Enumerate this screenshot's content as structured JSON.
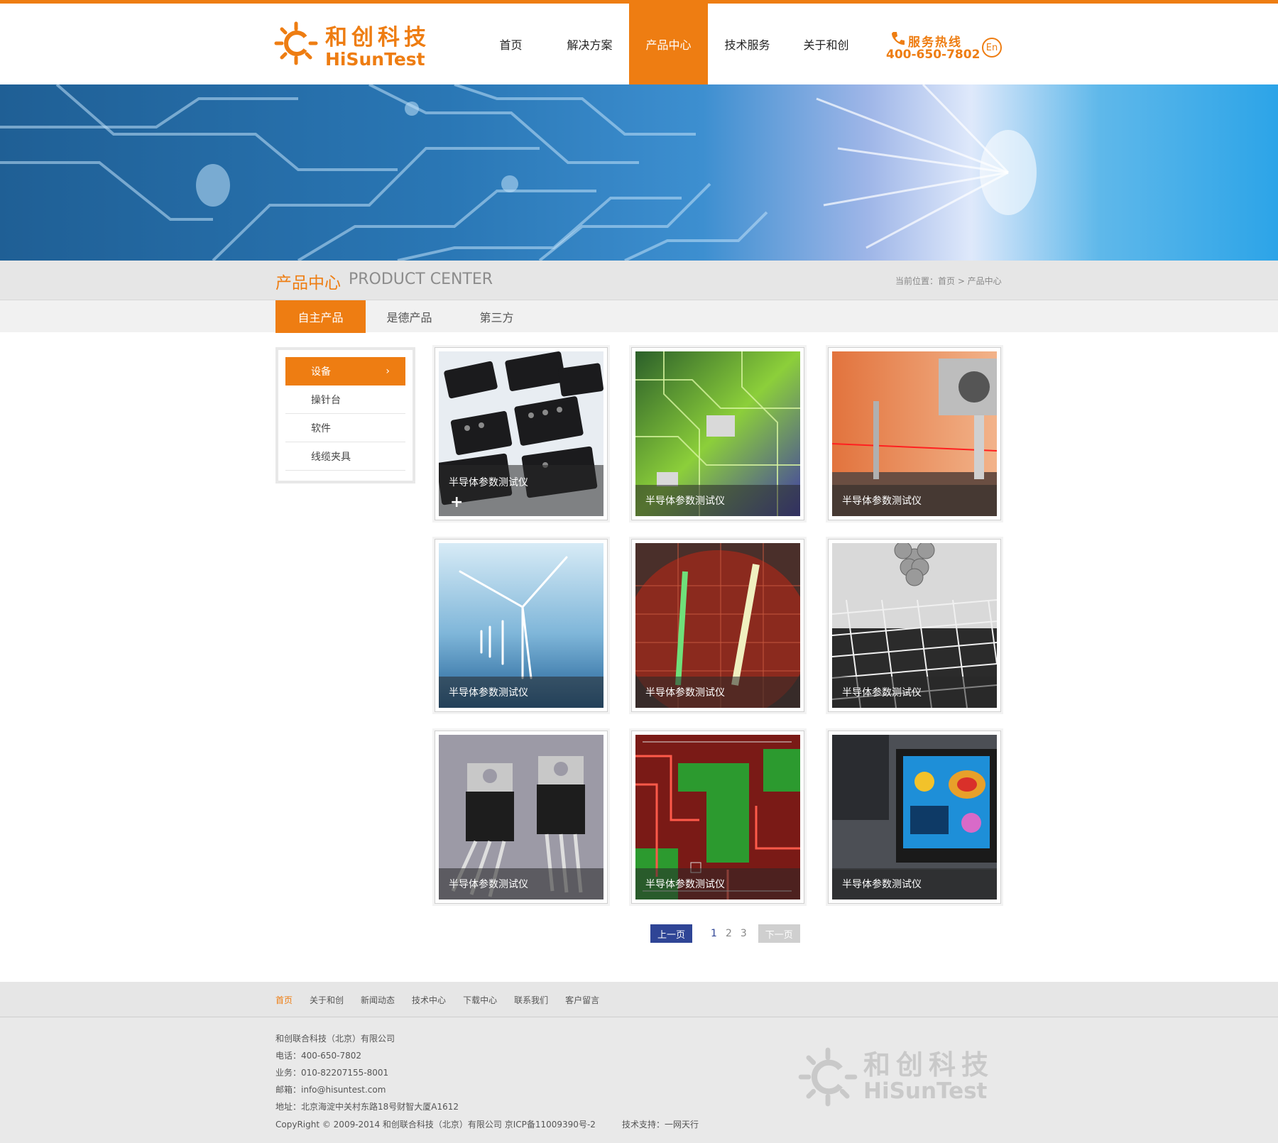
{
  "header": {
    "logo_cn": "和创科技",
    "logo_en": "HiSunTest",
    "nav": [
      {
        "label": "首页"
      },
      {
        "label": "解决方案"
      },
      {
        "label": "产品中心",
        "active": true
      },
      {
        "label": "技术服务"
      },
      {
        "label": "关于和创"
      }
    ],
    "hotline_label": "服务热线",
    "hotline_number": "400-650-7802",
    "language": "En"
  },
  "page_title": {
    "cn": "产品中心",
    "en": "PRODUCT CENTER",
    "breadcrumb": "当前位置：首页 > 产品中心"
  },
  "tabs": [
    {
      "label": "自主产品",
      "active": true
    },
    {
      "label": "是德产品"
    },
    {
      "label": "第三方"
    }
  ],
  "sidebar": {
    "items": [
      {
        "label": "设备",
        "active": true
      },
      {
        "label": "操针台"
      },
      {
        "label": "软件"
      },
      {
        "label": "线缆夹具"
      }
    ]
  },
  "products": [
    {
      "caption": "半导体参数测试仪",
      "image": "power-module"
    },
    {
      "caption": "半导体参数测试仪",
      "image": "circuit-board"
    },
    {
      "caption": "半导体参数测试仪",
      "image": "laser-bench"
    },
    {
      "caption": "半导体参数测试仪",
      "image": "wind-turbine"
    },
    {
      "caption": "半导体参数测试仪",
      "image": "silicon-wafer"
    },
    {
      "caption": "半导体参数测试仪",
      "image": "graphene-lattice"
    },
    {
      "caption": "半导体参数测试仪",
      "image": "transistors"
    },
    {
      "caption": "半导体参数测试仪",
      "image": "pcb-layout"
    },
    {
      "caption": "半导体参数测试仪",
      "image": "monitor-station"
    }
  ],
  "pager": {
    "prev": "上一页",
    "pages": [
      "1",
      "2",
      "3"
    ],
    "current": "1",
    "next": "下一页"
  },
  "footer": {
    "nav": [
      {
        "label": "首页",
        "active": true
      },
      {
        "label": "关于和创"
      },
      {
        "label": "新闻动态"
      },
      {
        "label": "技术中心"
      },
      {
        "label": "下载中心"
      },
      {
        "label": "联系我们"
      },
      {
        "label": "客户留言"
      }
    ],
    "company": "和创联合科技（北京）有限公司",
    "phone": "电话：400-650-7802",
    "business": "业务：010-82207155-8001",
    "email": "邮箱：info@hisuntest.com",
    "address": "地址：北京海淀中关村东路18号财智大厦A1612",
    "copyright": "CopyRight © 2009-2014 和创联合科技（北京）有限公司 京ICP备11009390号-2",
    "support": "技术支持：一网天行",
    "logo_cn": "和创科技",
    "logo_en": "HiSunTest"
  },
  "colors": {
    "accent": "#ee7d12",
    "pager_active": "#2f4596",
    "footer_bg": "#e9e9e9"
  }
}
